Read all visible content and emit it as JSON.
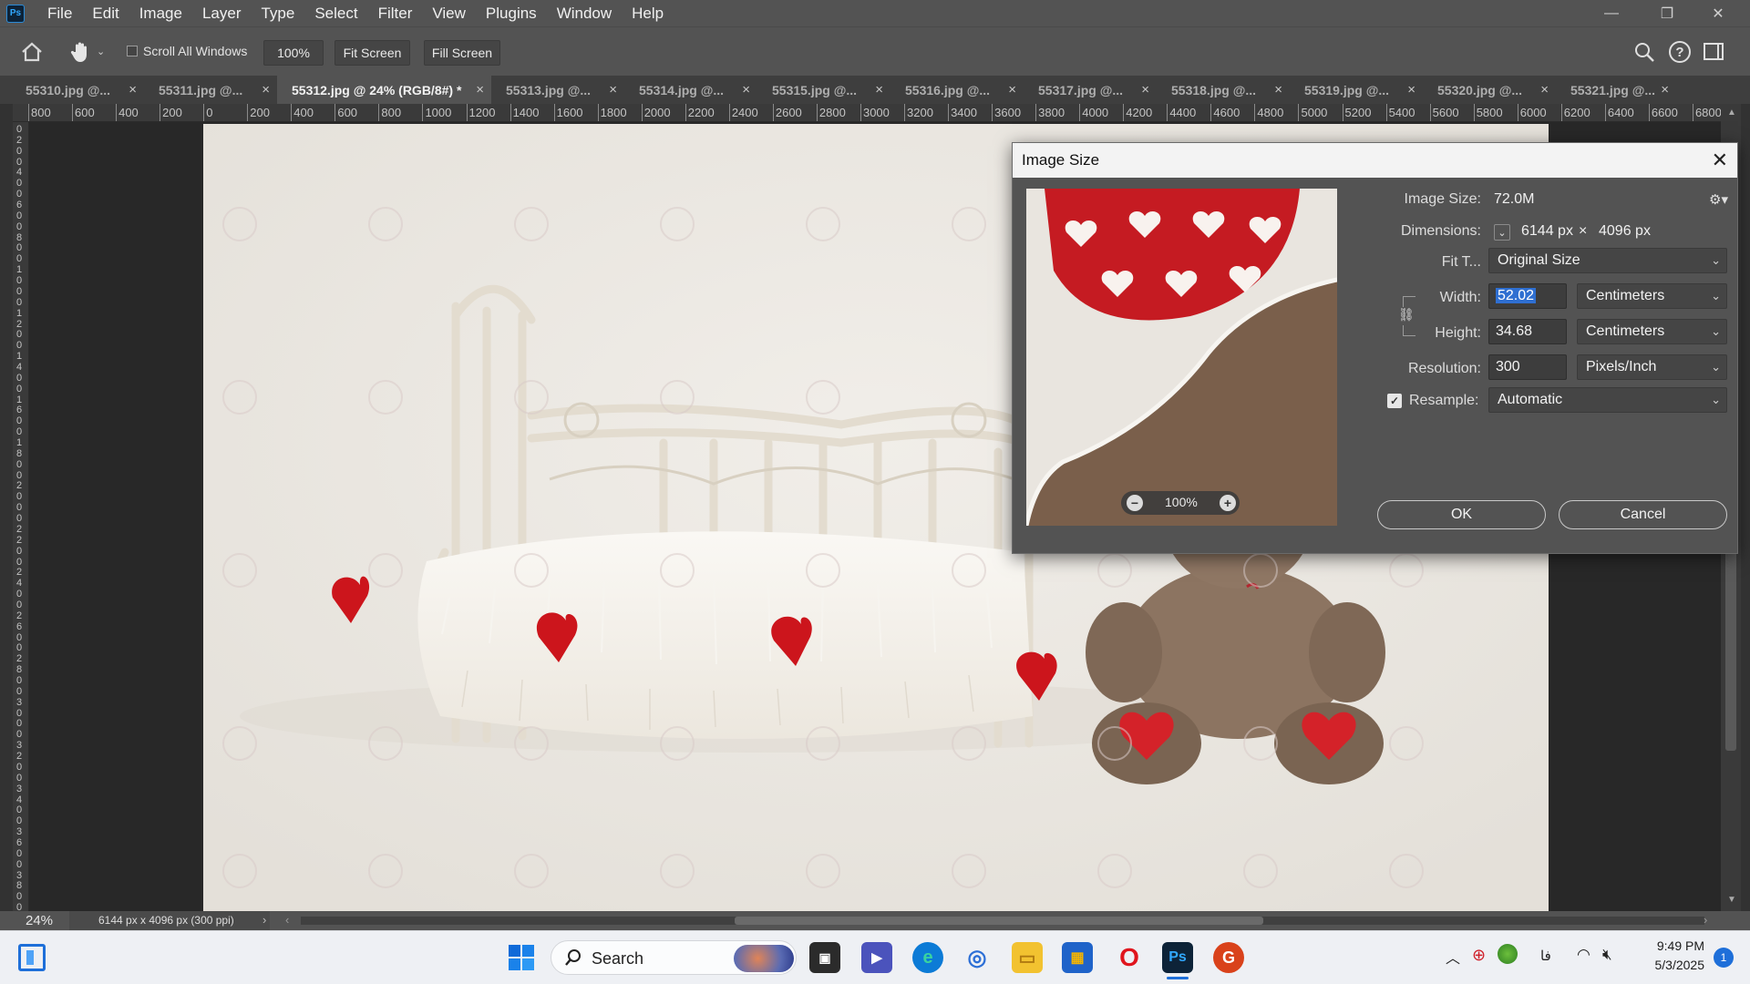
{
  "menubar": {
    "app_icon": "Ps",
    "items": [
      "File",
      "Edit",
      "Image",
      "Layer",
      "Type",
      "Select",
      "Filter",
      "View",
      "Plugins",
      "Window",
      "Help"
    ],
    "window_controls": {
      "minimize": "—",
      "maximize": "❐",
      "close": "✕"
    }
  },
  "options": {
    "scroll_all_windows": "Scroll All Windows",
    "scroll_all_checked": false,
    "zoom_value": "100%",
    "fit_screen": "Fit Screen",
    "fill_screen": "Fill Screen"
  },
  "tabs": [
    {
      "label": "55310.jpg @...",
      "active": false
    },
    {
      "label": "55311.jpg @...",
      "active": false
    },
    {
      "label": "55312.jpg @ 24% (RGB/8#) *",
      "active": true
    },
    {
      "label": "55313.jpg @...",
      "active": false
    },
    {
      "label": "55314.jpg @...",
      "active": false
    },
    {
      "label": "55315.jpg @...",
      "active": false
    },
    {
      "label": "55316.jpg @...",
      "active": false
    },
    {
      "label": "55317.jpg @...",
      "active": false
    },
    {
      "label": "55318.jpg @...",
      "active": false
    },
    {
      "label": "55319.jpg @...",
      "active": false
    },
    {
      "label": "55320.jpg @...",
      "active": false
    },
    {
      "label": "55321.jpg @...",
      "active": false
    }
  ],
  "tab_close": "×",
  "ruler_h": [
    "800",
    "600",
    "400",
    "200",
    "0",
    "200",
    "400",
    "600",
    "800",
    "1000",
    "1200",
    "1400",
    "1600",
    "1800",
    "2000",
    "2200",
    "2400",
    "2600",
    "2800",
    "3000",
    "3200",
    "3400",
    "3600",
    "3800",
    "4000",
    "4200",
    "4400",
    "4600",
    "4800",
    "5000",
    "5200",
    "5400",
    "5600",
    "5800",
    "6000",
    "6200",
    "6400",
    "6600",
    "6800"
  ],
  "ruler_v": [
    "0",
    "2",
    "0",
    "0",
    "4",
    "0",
    "0",
    "6",
    "0",
    "0",
    "8",
    "0",
    "0",
    "1",
    "0",
    "0",
    "0",
    "1",
    "2",
    "0",
    "0",
    "1",
    "4",
    "0",
    "0",
    "1",
    "6",
    "0",
    "0",
    "1",
    "8",
    "0",
    "0",
    "2",
    "0",
    "0",
    "0",
    "2",
    "2",
    "0",
    "0",
    "2",
    "4",
    "0",
    "0",
    "2",
    "6",
    "0",
    "0",
    "2",
    "8",
    "0",
    "0",
    "3",
    "0",
    "0",
    "0",
    "3",
    "2",
    "0",
    "0",
    "3",
    "4",
    "0",
    "0",
    "3",
    "6",
    "0",
    "0",
    "3",
    "8",
    "0",
    "0"
  ],
  "dialog": {
    "title": "Image Size",
    "close": "✕",
    "preview_zoom": "100%",
    "image_size_label": "Image Size:",
    "image_size_value": "72.0M",
    "dimensions_label": "Dimensions:",
    "dim_width": "6144 px",
    "dim_times": "×",
    "dim_height": "4096 px",
    "fit_label": "Fit T...",
    "fit_value": "Original Size",
    "width_label": "Width:",
    "width_value": "52.02",
    "width_unit": "Centimeters",
    "height_label": "Height:",
    "height_value": "34.68",
    "height_unit": "Centimeters",
    "resolution_label": "Resolution:",
    "resolution_value": "300",
    "resolution_unit": "Pixels/Inch",
    "resample_label": "Resample:",
    "resample_checked": true,
    "resample_value": "Automatic",
    "ok": "OK",
    "cancel": "Cancel"
  },
  "status": {
    "zoom": "24%",
    "doc_info": "6144 px x 4096 px (300 ppi)"
  },
  "taskbar": {
    "search_placeholder": "Search",
    "time": "9:49 PM",
    "date": "5/3/2025",
    "notification_count": "1",
    "lang": "فا"
  },
  "colors": {
    "ps_blue": "#31a8ff",
    "selection": "#2f6fd1",
    "heart_red": "#c8141a"
  }
}
